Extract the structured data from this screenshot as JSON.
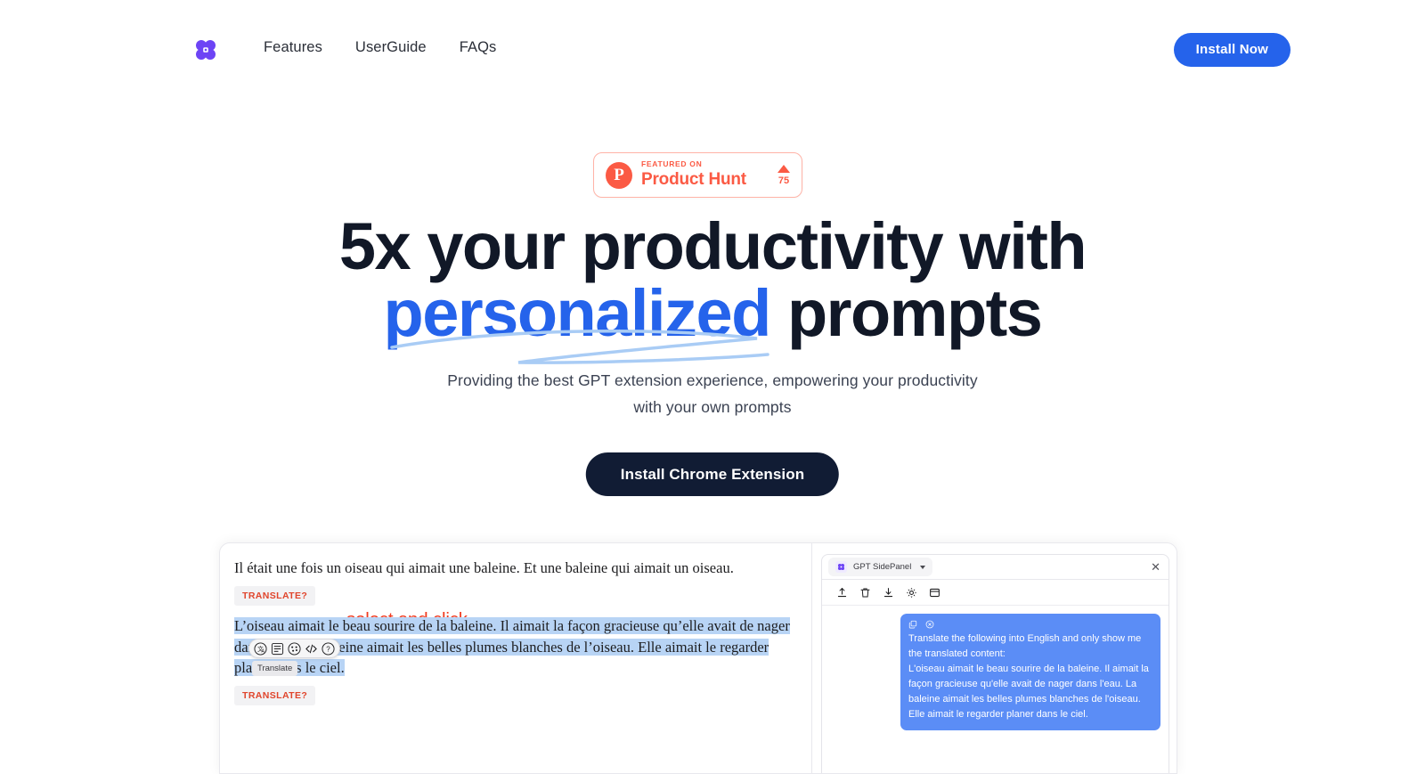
{
  "header": {
    "logo_icon": "atom-flower-logo",
    "logo_color": "#6d44f5",
    "nav": [
      {
        "label": "Features"
      },
      {
        "label": "UserGuide"
      },
      {
        "label": "FAQs"
      }
    ],
    "install_button": "Install Now",
    "install_button_color": "#2563eb"
  },
  "badge": {
    "initial": "P",
    "featured_on": "FEATURED ON",
    "product": "Product Hunt",
    "vote_count": "75",
    "accent_color": "#fb5a44"
  },
  "hero": {
    "title_line1": "5x your productivity with",
    "title_highlight": "personalized",
    "title_line2_tail": " prompts",
    "highlight_color": "#2563eb",
    "subtitle_line1": "Providing the best GPT extension experience, empowering your productivity",
    "subtitle_line2": "with your own prompts",
    "cta_label": "Install Chrome Extension",
    "cta_color": "#111c34"
  },
  "demo": {
    "left": {
      "paragraph1": "Il était une fois un oiseau qui aimait une baleine. Et une baleine qui aimait un oiseau.",
      "translate_badge_1": "TRANSLATE?",
      "annotation": "select and click",
      "annotation_color": "#f03b20",
      "selected_text": "L’oiseau aimait le beau sourire de la baleine. Il aimait la façon gracieuse qu’elle avait de nager dans l’eau. La baleine aimait les belles plumes blanches de l’oiseau. Elle aimait le regarder planer dans le ciel.",
      "translate_badge_2": "TRANSLATE?",
      "toolbar_icons": [
        "translate-icon",
        "summarize-icon",
        "palette-icon",
        "code-icon",
        "help-icon"
      ],
      "tooltip": "Translate",
      "selection_color": "#b8d4f5"
    },
    "right": {
      "tab_label": "GPT SidePanel",
      "close_icon": "close-icon",
      "toolbar_icons": [
        "upload-icon",
        "trash-icon",
        "download-icon",
        "gear-icon",
        "window-icon"
      ],
      "bubble_icons": [
        "copy-icon",
        "close-circle-icon"
      ],
      "bubble_color": "#5b8df6",
      "bubble_line1": "Translate the following into English and only show me the translated content:",
      "bubble_line2": "L'oiseau aimait le beau sourire de la baleine. Il aimait la façon gracieuse qu'elle avait de nager dans l'eau. La baleine aimait les belles plumes blanches de l'oiseau. Elle aimait le regarder planer dans le ciel."
    }
  }
}
